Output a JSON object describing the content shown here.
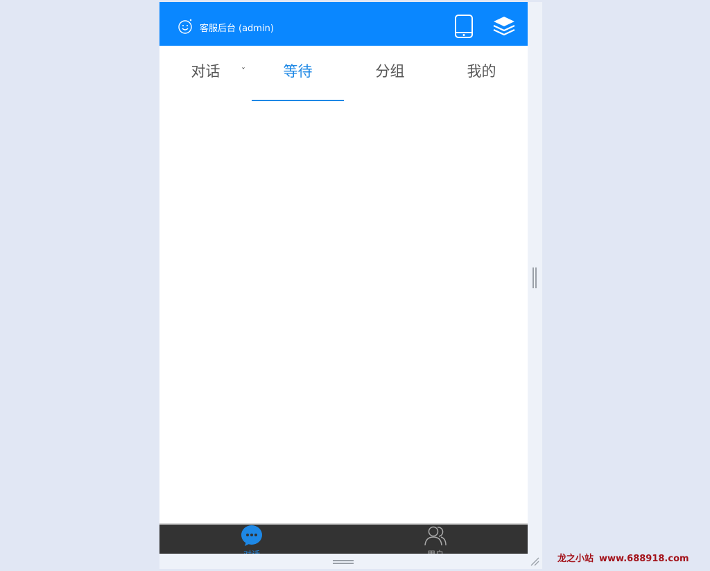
{
  "header": {
    "title": "客服后台",
    "user": "(admin)",
    "brand_color": "#0a87ff",
    "icons": [
      "smile-logo-icon",
      "tablet-icon",
      "layers-icon"
    ]
  },
  "tabs": [
    {
      "label": "对话",
      "active": false
    },
    {
      "label": "等待",
      "active": true
    },
    {
      "label": "分组",
      "active": false
    },
    {
      "label": "我的",
      "active": false
    }
  ],
  "tab_caret": "ˇ",
  "bottom_nav": [
    {
      "label": "对话",
      "icon": "chat-bubble-icon",
      "active": true
    },
    {
      "label": "用户",
      "icon": "users-icon",
      "active": false
    }
  ],
  "watermark": {
    "text": "龙之小站",
    "url": "www.688918.com"
  },
  "colors": {
    "accent": "#1e88e5",
    "bottom_bar": "#333333",
    "page_bg": "#e1e7f4"
  }
}
